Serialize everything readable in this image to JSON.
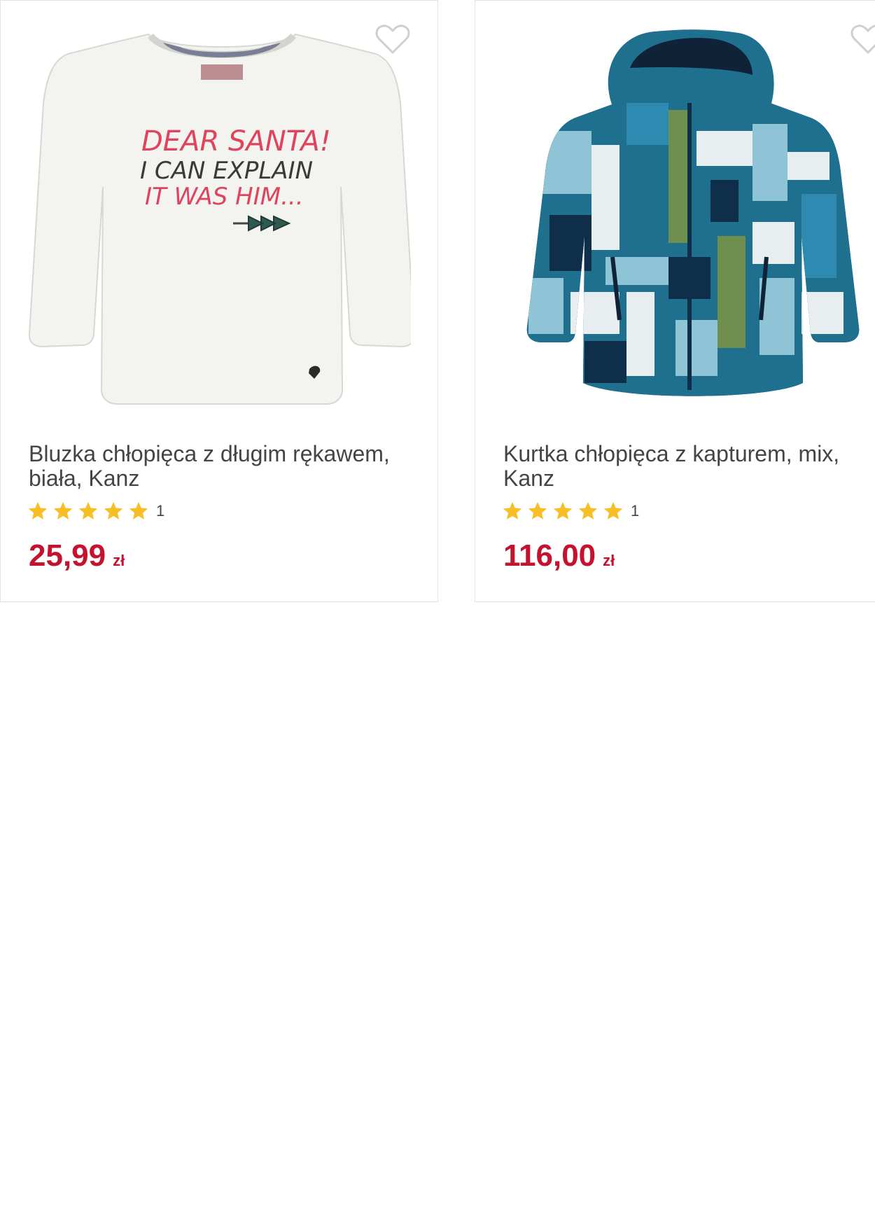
{
  "products": [
    {
      "title": "Bluzka chłopięca z długim rękawem, biała, Kanz",
      "rating_count": "1",
      "rating_value": 5,
      "price": "25,99",
      "currency": "zł",
      "favorite_icon": "heart-outline-icon",
      "image": {
        "kind": "white long-sleeve shirt",
        "print_lines": [
          "DEAR SANTA!",
          "I CAN EXPLAIN",
          "IT WAS HIM..."
        ]
      }
    },
    {
      "title": "Kurtka chłopięca z kapturem, mix, Kanz",
      "rating_count": "1",
      "rating_value": 5,
      "price": "116,00",
      "currency": "zł",
      "favorite_icon": "heart-outline-icon",
      "image": {
        "kind": "blue patterned hooded jacket"
      }
    }
  ],
  "colors": {
    "price": "#c4122f",
    "star": "#f6bf26",
    "border": "#e3e3e3",
    "text": "#444444"
  }
}
